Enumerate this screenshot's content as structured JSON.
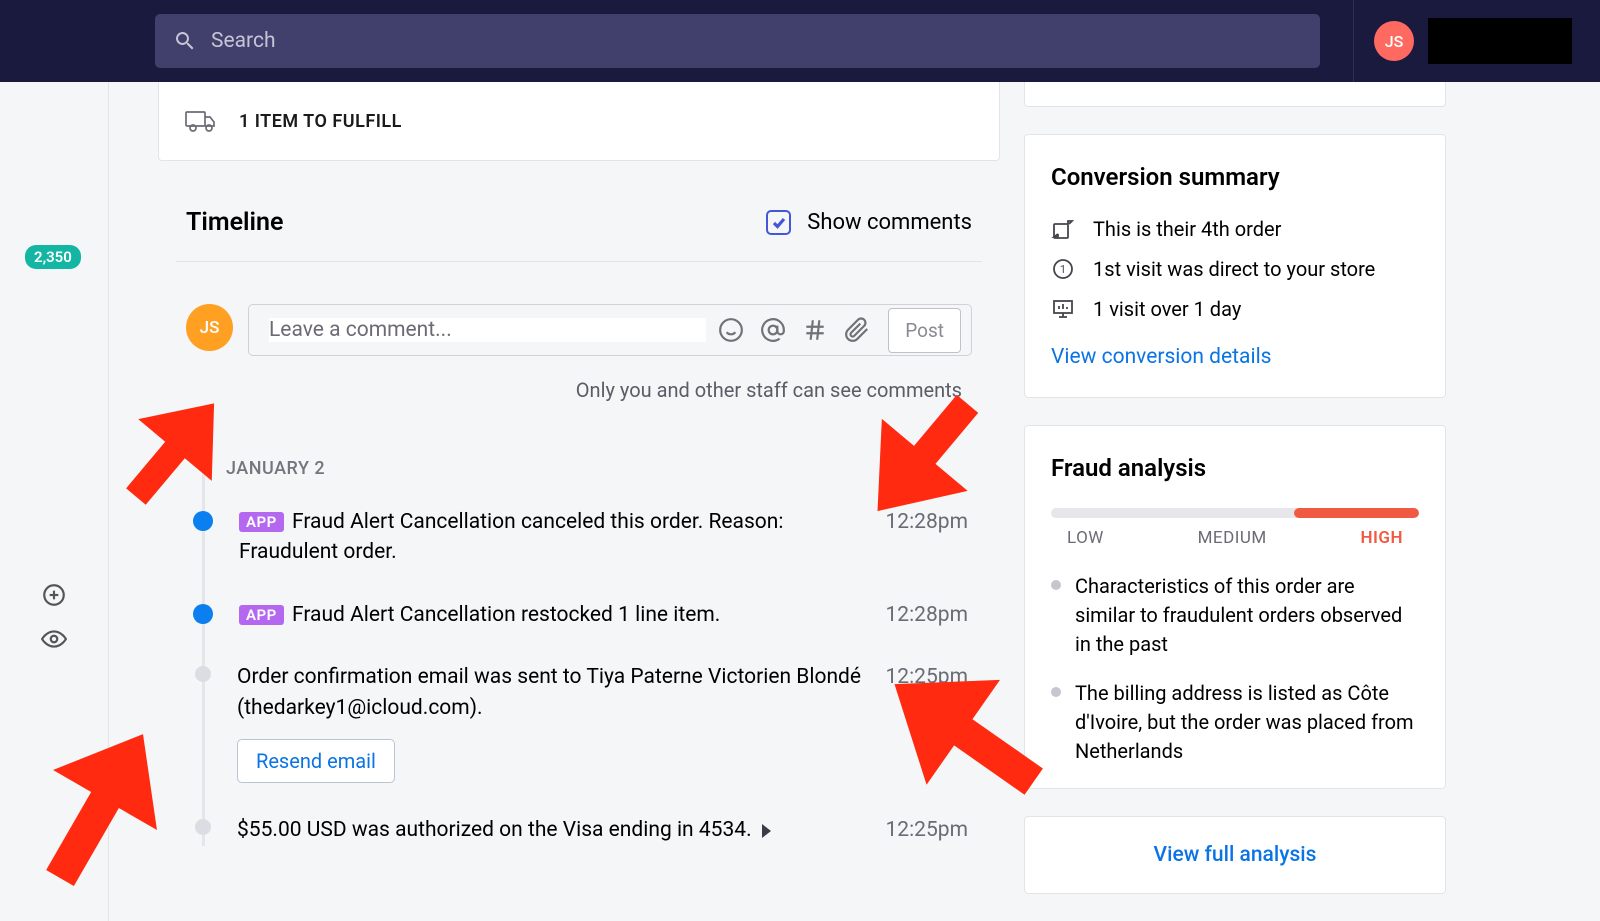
{
  "topbar": {
    "search_placeholder": "Search",
    "avatar_initials": "JS"
  },
  "left_rail": {
    "count_badge": "2,350"
  },
  "fulfill_card": {
    "text": "1 ITEM TO FULFILL"
  },
  "timeline": {
    "title": "Timeline",
    "show_comments_label": "Show comments",
    "avatar_initials": "JS",
    "comment_placeholder": "Leave a comment...",
    "post_label": "Post",
    "helper_text": "Only you and other staff can see comments",
    "date_heading": "JANUARY 2",
    "items": [
      {
        "tag": "APP",
        "text": "Fraud Alert Cancellation canceled this order. Reason: Fraudulent order.",
        "time": "12:28pm",
        "dot": "blue"
      },
      {
        "tag": "APP",
        "text": "Fraud Alert Cancellation restocked 1 line item.",
        "time": "12:28pm",
        "dot": "blue"
      },
      {
        "text": "Order confirmation email was sent to Tiya Paterne Victorien Blondé (thedarkey1@icloud.com).",
        "time": "12:25pm",
        "dot": "grey",
        "action": "Resend email"
      },
      {
        "text": "$55.00 USD was authorized on the Visa ending in 4534.",
        "time": "12:25pm",
        "dot": "grey",
        "caret": true
      }
    ]
  },
  "conversion": {
    "title": "Conversion summary",
    "rows": [
      "This is their 4th order",
      "1st visit was direct to your store",
      "1 visit over 1 day"
    ],
    "link": "View conversion details"
  },
  "fraud": {
    "title": "Fraud analysis",
    "labels": {
      "low": "LOW",
      "med": "MEDIUM",
      "high": "HIGH"
    },
    "points": [
      "Characteristics of this order are similar to fraudulent orders observed in the past",
      "The billing address is listed as Côte d'Ivoire, but the order was placed from Netherlands"
    ],
    "full_link": "View full analysis"
  }
}
